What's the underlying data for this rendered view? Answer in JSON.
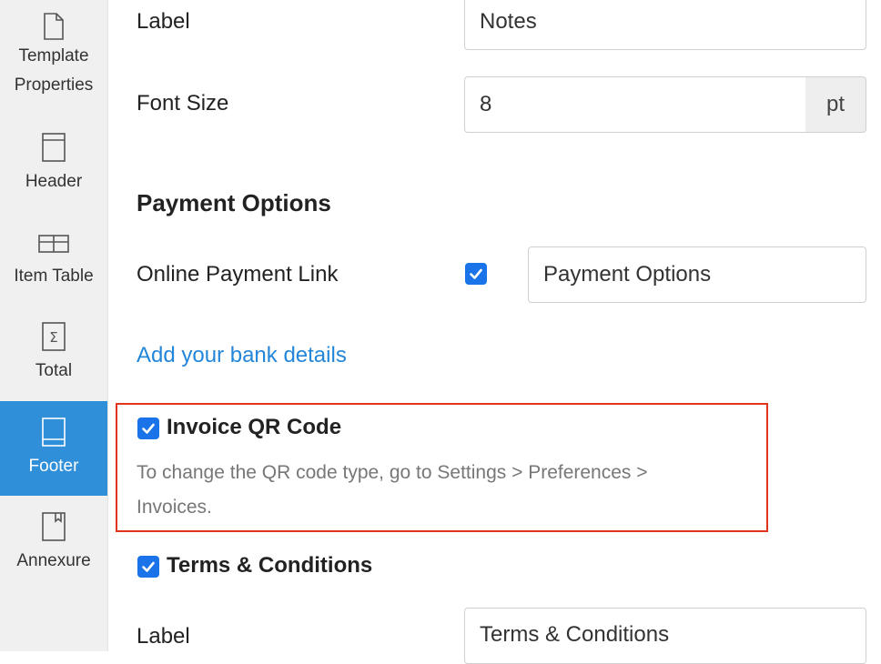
{
  "sidebar": {
    "items": [
      {
        "label_line1": "Template",
        "label_line2": "Properties",
        "icon": "page-icon"
      },
      {
        "label": "Header",
        "icon": "header-icon"
      },
      {
        "label": "Item Table",
        "icon": "table-icon"
      },
      {
        "label": "Total",
        "icon": "sigma-icon"
      },
      {
        "label": "Footer",
        "icon": "footer-icon",
        "active": true
      },
      {
        "label": "Annexure",
        "icon": "bookmark-page-icon"
      }
    ]
  },
  "main": {
    "label_row": {
      "label": "Label",
      "value": "Notes"
    },
    "font_size_row": {
      "label": "Font Size",
      "value": "8",
      "unit": "pt"
    },
    "payment_options": {
      "title": "Payment Options",
      "online_payment_link": {
        "label": "Online Payment Link",
        "checked": true,
        "value": "Payment Options"
      },
      "bank_link": "Add your bank details"
    },
    "qr_code": {
      "label": "Invoice QR Code",
      "checked": true,
      "hint_line1": "To change the QR code type, go to Settings > Preferences >",
      "hint_line2": "Invoices."
    },
    "terms": {
      "label": "Terms & Conditions",
      "checked": true,
      "field_label": "Label",
      "field_value": "Terms & Conditions"
    }
  },
  "colors": {
    "accent": "#2f8fd8",
    "checkbox": "#1a73e8",
    "link": "#2486d9",
    "highlight_border": "#e0341c"
  }
}
